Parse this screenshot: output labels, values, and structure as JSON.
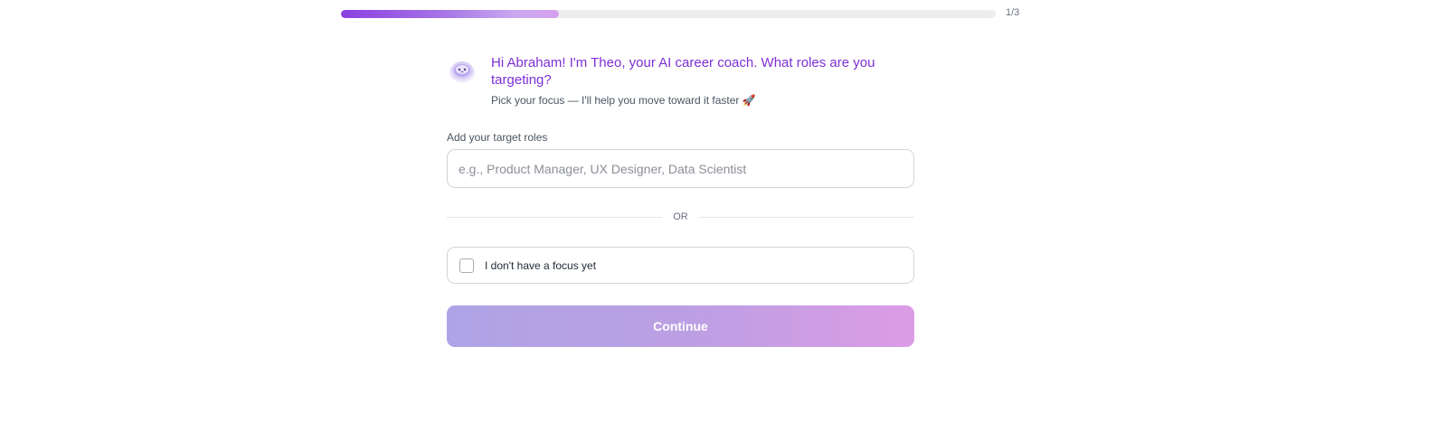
{
  "progress": {
    "fraction": 0.333,
    "count_label": "1/3",
    "fill_color": "#8b3fe0"
  },
  "coach": {
    "avatar_icon": "theo-robot-avatar-icon",
    "title": "Hi Abraham! I'm Theo, your AI career coach. What roles are you targeting?",
    "subtitle": "Pick your focus — I'll help you move toward it faster 🚀"
  },
  "roles": {
    "label": "Add your target roles",
    "value": "",
    "placeholder": "e.g., Product Manager, UX Designer, Data Scientist"
  },
  "divider": {
    "text": "OR"
  },
  "no_focus": {
    "label": "I don't have a focus yet",
    "checked": false
  },
  "continue": {
    "label": "Continue"
  },
  "colors": {
    "accent": "#7e2fd6",
    "button_gradient_start": "#aea4e5",
    "button_gradient_end": "#dc9ce6"
  }
}
